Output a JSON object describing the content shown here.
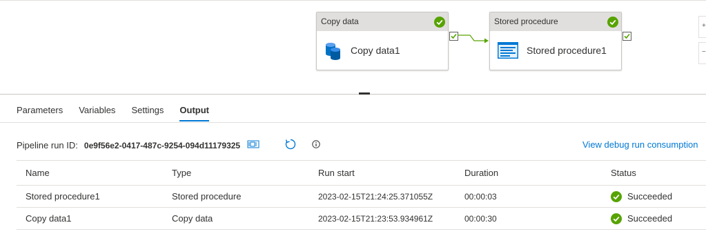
{
  "pipeline": {
    "activities": [
      {
        "header": "Copy data",
        "name": "Copy data1"
      },
      {
        "header": "Stored procedure",
        "name": "Stored procedure1"
      }
    ]
  },
  "tabs": [
    "Parameters",
    "Variables",
    "Settings",
    "Output"
  ],
  "active_tab": "Output",
  "output": {
    "run_id_label": "Pipeline run ID:",
    "run_id": "0e9f56e2-0417-487c-9254-094d11179325",
    "consumption_link": "View debug run consumption",
    "columns": [
      "Name",
      "Type",
      "Run start",
      "Duration",
      "Status"
    ],
    "rows": [
      {
        "name": "Stored procedure1",
        "type": "Stored procedure",
        "run_start": "2023-02-15T21:24:25.371055Z",
        "duration": "00:00:03",
        "status": "Succeeded"
      },
      {
        "name": "Copy data1",
        "type": "Copy data",
        "run_start": "2023-02-15T21:23:53.934961Z",
        "duration": "00:00:30",
        "status": "Succeeded"
      }
    ]
  },
  "colors": {
    "accent": "#0078d4",
    "success": "#57a300"
  }
}
